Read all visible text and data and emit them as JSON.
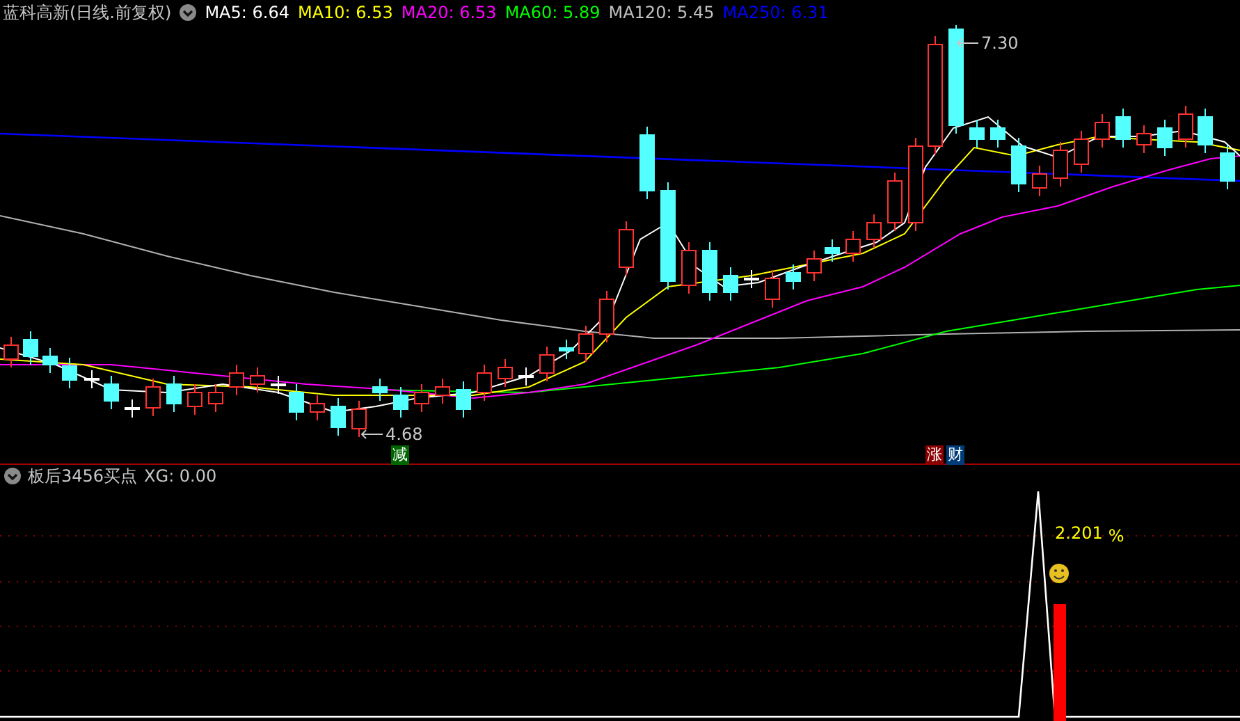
{
  "stock_title": "蓝科高新(日线.前复权)",
  "indicators": [
    {
      "label": "MA5: 6.64",
      "color": "#ffffff"
    },
    {
      "label": "MA10: 6.53",
      "color": "#ffff00"
    },
    {
      "label": "MA20: 6.53",
      "color": "#ff00ff"
    },
    {
      "label": "MA60: 5.89",
      "color": "#00ff00"
    },
    {
      "label": "MA120: 5.45",
      "color": "#c0c0c0"
    },
    {
      "label": "MA250: 6.31",
      "color": "#0000ff"
    }
  ],
  "price_labels": [
    {
      "kind": "high",
      "text": "7.30"
    },
    {
      "kind": "low",
      "text": "4.68"
    }
  ],
  "markers": [
    {
      "text": "减",
      "color": "#006600"
    },
    {
      "text": "涨",
      "color": "#8b0000"
    },
    {
      "text": "财",
      "color": "#003c78"
    }
  ],
  "sub_panel": {
    "title": "板后3456买点",
    "reading": "XG: 0.00",
    "value_label": "2.201",
    "unit": "%"
  }
}
